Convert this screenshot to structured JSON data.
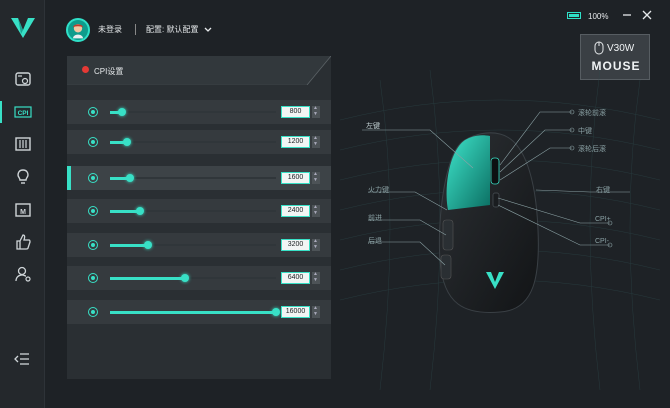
{
  "app": {
    "brand_color": "#38e0c6"
  },
  "sidebar": {
    "items": [
      {
        "name": "display-settings-icon",
        "active": false
      },
      {
        "name": "cpi-icon",
        "label": "CPI",
        "active": true
      },
      {
        "name": "keys-icon",
        "active": false
      },
      {
        "name": "light-icon",
        "active": false
      },
      {
        "name": "macro-icon",
        "label": "M",
        "active": false
      },
      {
        "name": "thumbs-up-icon",
        "active": false
      },
      {
        "name": "user-settings-icon",
        "active": false
      }
    ],
    "collapse_icon": "collapse-icon"
  },
  "header": {
    "user_status": "未登录",
    "profile_label": "配置: 默认配置",
    "battery_percent": "100%"
  },
  "device": {
    "model": "V30W",
    "type": "MOUSE"
  },
  "cpi": {
    "title": "CPI设置",
    "selected_index": 2,
    "levels": [
      {
        "value": "800",
        "fraction": 0.07
      },
      {
        "value": "1200",
        "fraction": 0.1
      },
      {
        "value": "1600",
        "fraction": 0.12
      },
      {
        "value": "2400",
        "fraction": 0.18
      },
      {
        "value": "3200",
        "fraction": 0.23
      },
      {
        "value": "6400",
        "fraction": 0.45
      },
      {
        "value": "16000",
        "fraction": 1.0
      }
    ]
  },
  "mouse_labels": {
    "left_click": "左键",
    "scroll_forward": "滚轮前滚",
    "middle": "中键",
    "scroll_back": "滚轮后滚",
    "right_click": "右键",
    "fire_key": "火力键",
    "forward": "前进",
    "back": "后退",
    "cpi_plus": "CPI+",
    "cpi_minus": "CPI-"
  }
}
